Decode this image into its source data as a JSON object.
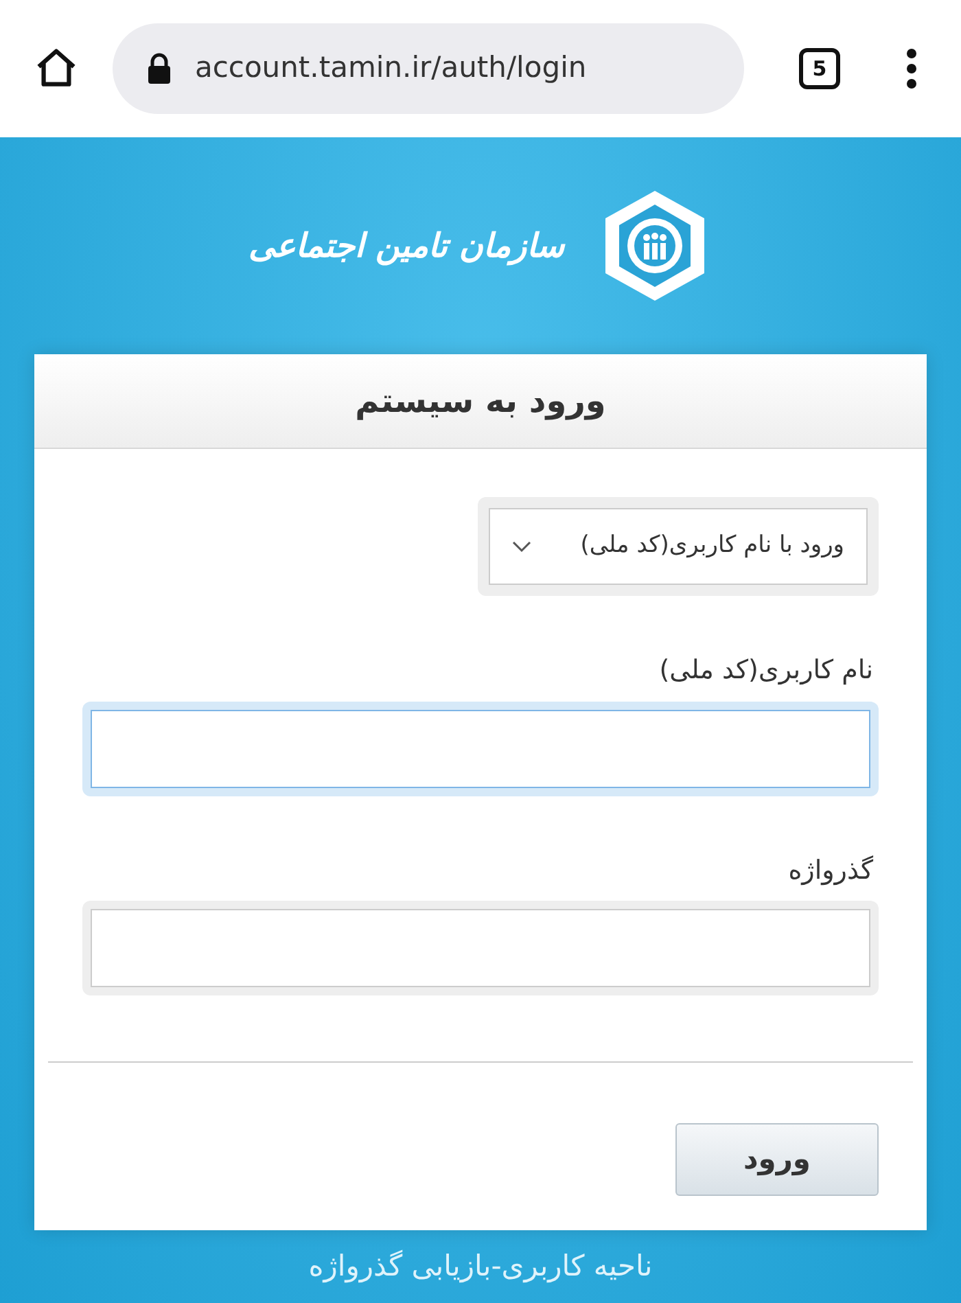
{
  "browser": {
    "url": "account.tamin.ir/auth/login",
    "tab_count": "5"
  },
  "logo": {
    "text": "سازمان تامین اجتماعی"
  },
  "card": {
    "title": "ورود به سیستم",
    "login_method": {
      "value": "ورود با نام کاربری(کد ملی)"
    },
    "fields": [
      {
        "label": "نام کاربری(کد ملی)",
        "focused": true
      },
      {
        "label": "گذرواژه",
        "focused": false
      }
    ],
    "submit": "ورود"
  },
  "footer": {
    "link": "ناحیه کاربری-بازیابی گذرواژه"
  }
}
